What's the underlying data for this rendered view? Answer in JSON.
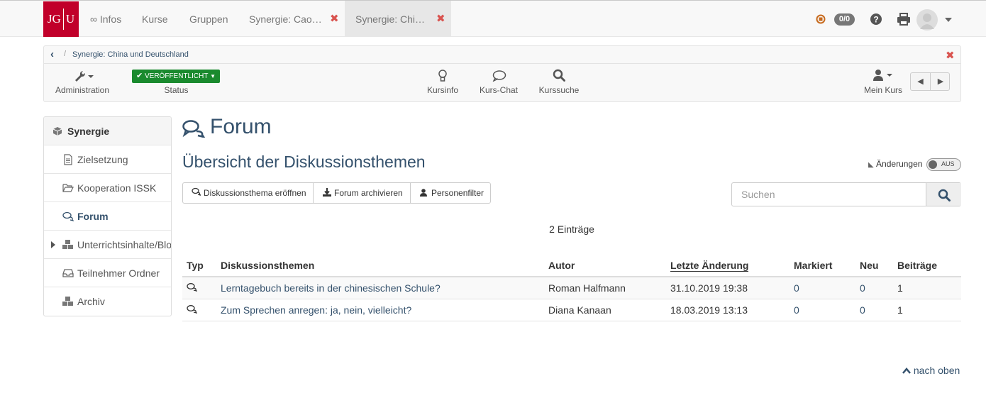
{
  "topnav": {
    "logo_left": "JG",
    "logo_right": "U",
    "infos": "∞ Infos",
    "kurse": "Kurse",
    "gruppen": "Gruppen",
    "tab1": "Synergie: Cao…",
    "tab2": "Synergie: Chi…",
    "close_glyph": "✖",
    "counter": "0/0"
  },
  "breadcrumb": {
    "back_glyph": "‹",
    "separator": "/",
    "current": "Synergie: China und Deutschland"
  },
  "toolbar": {
    "administration": "Administration",
    "status_badge": "VERÖFFENTLICHT",
    "status": "Status",
    "kursinfo": "Kursinfo",
    "kurs_chat": "Kurs-Chat",
    "kurssuche": "Kurssuche",
    "mein_kurs": "Mein Kurs"
  },
  "sidebar": {
    "items": [
      {
        "label": "Synergie",
        "icon": "cube-icon"
      },
      {
        "label": "Zielsetzung",
        "icon": "file-icon"
      },
      {
        "label": "Kooperation ISSK",
        "icon": "folder-icon"
      },
      {
        "label": "Forum",
        "icon": "comments-icon"
      },
      {
        "label": "Unterrichtsinhalte/Blog",
        "icon": "cubes-icon"
      },
      {
        "label": "Teilnehmer Ordner",
        "icon": "inbox-icon"
      },
      {
        "label": "Archiv",
        "icon": "cubes-icon"
      }
    ]
  },
  "main": {
    "title": "Forum",
    "subtitle": "Übersicht der Diskussionsthemen",
    "changes_label": "Änderungen",
    "toggle_label": "AUS",
    "buttons": {
      "open_topic": "Diskussionsthema eröffnen",
      "archive": "Forum archivieren",
      "person_filter": "Personenfilter"
    },
    "search_placeholder": "Suchen",
    "entries": "2 Einträge",
    "table": {
      "headers": [
        "Typ",
        "Diskussionsthemen",
        "Autor",
        "Letzte Änderung",
        "Markiert",
        "Neu",
        "Beiträge"
      ],
      "rows": [
        {
          "topic": "Lerntagebuch bereits in der chinesischen Schule?",
          "author": "Roman Halfmann",
          "date": "31.10.2019 19:38",
          "marked": "0",
          "new": "0",
          "posts": "1"
        },
        {
          "topic": "Zum Sprechen anregen: ja, nein, vielleicht?",
          "author": "Diana Kanaan",
          "date": "18.03.2019 13:13",
          "marked": "0",
          "new": "0",
          "posts": "1"
        }
      ]
    },
    "to_top": "nach oben"
  },
  "colors": {
    "brand": "#c1002a",
    "link": "#34516c",
    "published": "#1a8a2e",
    "close": "#d9534f"
  }
}
